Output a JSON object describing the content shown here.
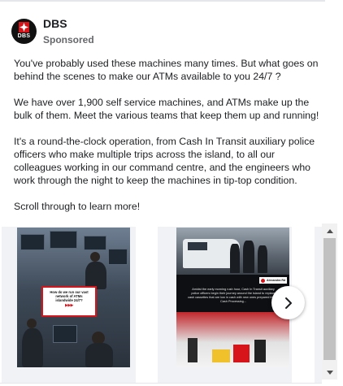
{
  "post": {
    "page_name": "DBS",
    "sponsored_label": "Sponsored",
    "avatar": {
      "logo_text": "DBS",
      "icon": "dbs-logo-icon"
    },
    "paragraphs": [
      "You've probably used these machines many times. But what goes on behind the scenes to make our ATMs available to you 24/7 ?",
      "We have over 1,900 self service machines, and ATMs make up the bulk of them. Meet the various teams that keep them up and running!",
      "It's a round-the-clock operation, from Cash In Transit auxiliary police officers who make multiple trips across the island, to all our colleagues working in our command centre, and the engineers who work through the night to keep the machines in tip-top condition.",
      "Scroll through to learn more!"
    ]
  },
  "carousel": {
    "cards": [
      {
        "overlay_lines": [
          "How do we run our vast",
          "network of ATMs",
          "islandwide 24/7?"
        ],
        "overlay_arrows": "▶▶▶"
      },
      {
        "tag": "Alexandra Rd",
        "caption": "Amidst the early morning rush hour, Cash In Transit auxiliary police officers begin their journey around the island to replace cash cassettes that are low in cash with new ones prepared by our Cash Processing..."
      }
    ],
    "next_icon": "chevron-right-icon"
  },
  "scrollbar": {
    "up_icon": "arrow-up-icon",
    "down_icon": "arrow-down-icon"
  },
  "colors": {
    "brand_red": "#d7141a",
    "text_primary": "#1c1e21",
    "text_secondary": "#65676b"
  }
}
